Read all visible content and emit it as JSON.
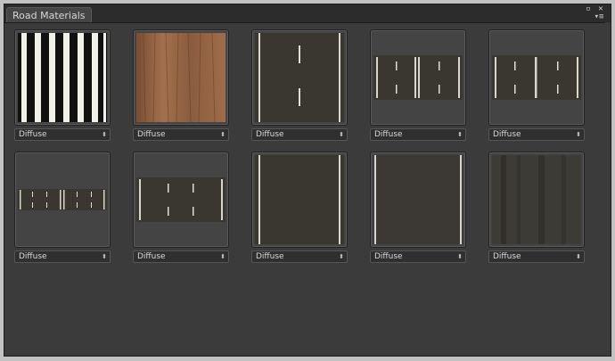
{
  "window": {
    "tab_title": "Road Materials",
    "controls": {
      "max_icon": "▫",
      "close_icon": "✕",
      "menu_icon": "▾≡"
    }
  },
  "materials": [
    {
      "shader": "Diffuse",
      "preview": "stripes-white"
    },
    {
      "shader": "Diffuse",
      "preview": "wood"
    },
    {
      "shader": "Diffuse",
      "preview": "road-two-lane"
    },
    {
      "shader": "Diffuse",
      "preview": "road-double-wide"
    },
    {
      "shader": "Diffuse",
      "preview": "road-double-wide-alt"
    },
    {
      "shader": "Diffuse",
      "preview": "road-double-small"
    },
    {
      "shader": "Diffuse",
      "preview": "road-four-lane"
    },
    {
      "shader": "Diffuse",
      "preview": "road-plain-edges"
    },
    {
      "shader": "Diffuse",
      "preview": "road-edges-only"
    },
    {
      "shader": "Diffuse",
      "preview": "asphalt-streaks"
    }
  ],
  "dropdown_arrow": "⬍"
}
